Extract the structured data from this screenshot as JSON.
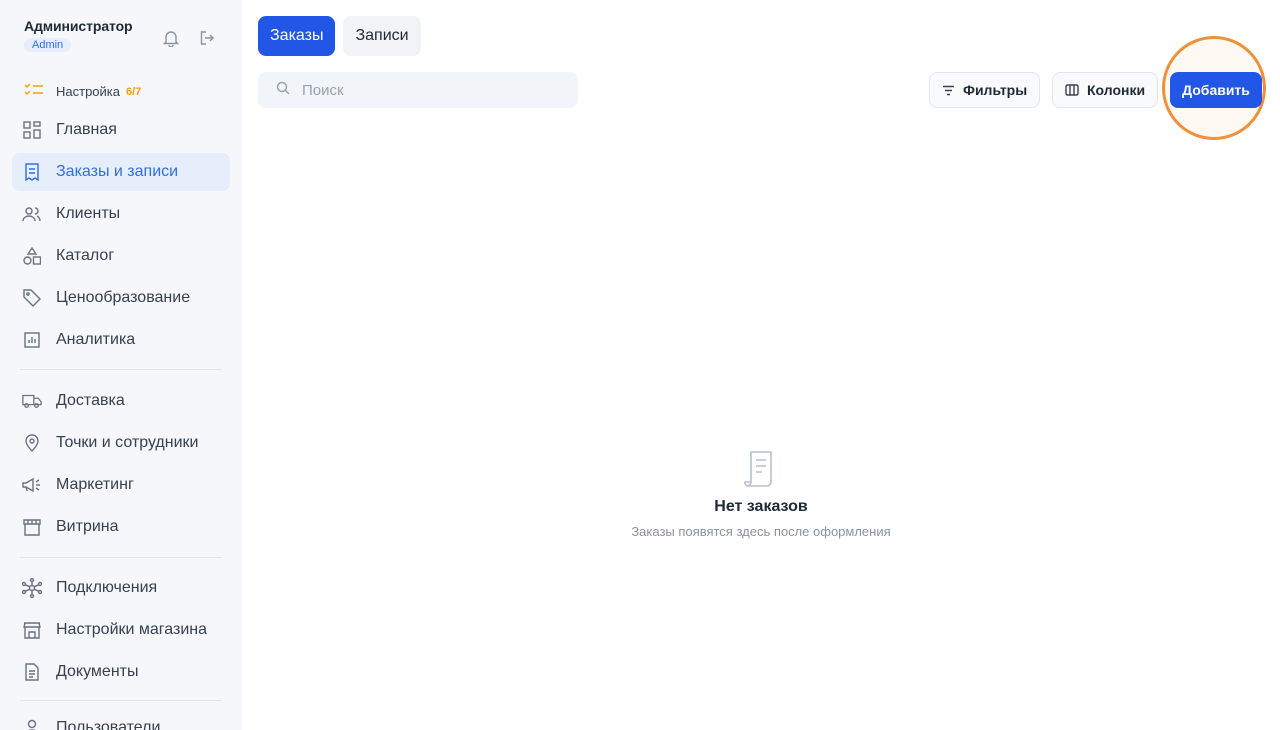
{
  "user": {
    "name": "Администратор",
    "role": "Admin"
  },
  "setup": {
    "label": "Настройка",
    "progress": "6/7"
  },
  "nav_group1": [
    {
      "label": "Главная",
      "icon": "grid-icon"
    },
    {
      "label": "Заказы и записи",
      "icon": "receipt-icon",
      "active": true
    },
    {
      "label": "Клиенты",
      "icon": "users-icon"
    },
    {
      "label": "Каталог",
      "icon": "shapes-icon"
    },
    {
      "label": "Ценообразование",
      "icon": "tag-icon"
    },
    {
      "label": "Аналитика",
      "icon": "chart-icon"
    }
  ],
  "nav_group2": [
    {
      "label": "Доставка",
      "icon": "truck-icon"
    },
    {
      "label": "Точки и сотрудники",
      "icon": "map-pin-icon"
    },
    {
      "label": "Маркетинг",
      "icon": "megaphone-icon"
    },
    {
      "label": "Витрина",
      "icon": "storefront-icon"
    }
  ],
  "nav_group3": [
    {
      "label": "Подключения",
      "icon": "network-icon"
    },
    {
      "label": "Настройки магазина",
      "icon": "store-icon"
    },
    {
      "label": "Документы",
      "icon": "document-icon"
    }
  ],
  "nav_group4": [
    {
      "label": "Пользователи",
      "icon": "user-icon"
    }
  ],
  "tabs": [
    {
      "label": "Заказы",
      "active": true
    },
    {
      "label": "Записи",
      "active": false
    }
  ],
  "search": {
    "placeholder": "Поиск"
  },
  "toolbar": {
    "filters": "Фильтры",
    "columns": "Колонки",
    "add": "Добавить"
  },
  "empty_state": {
    "title": "Нет заказов",
    "subtitle": "Заказы появятся здесь после оформления"
  },
  "colors": {
    "accent": "#2156e6",
    "active_nav_bg": "#e6eefb",
    "highlight": "#f0913a"
  }
}
